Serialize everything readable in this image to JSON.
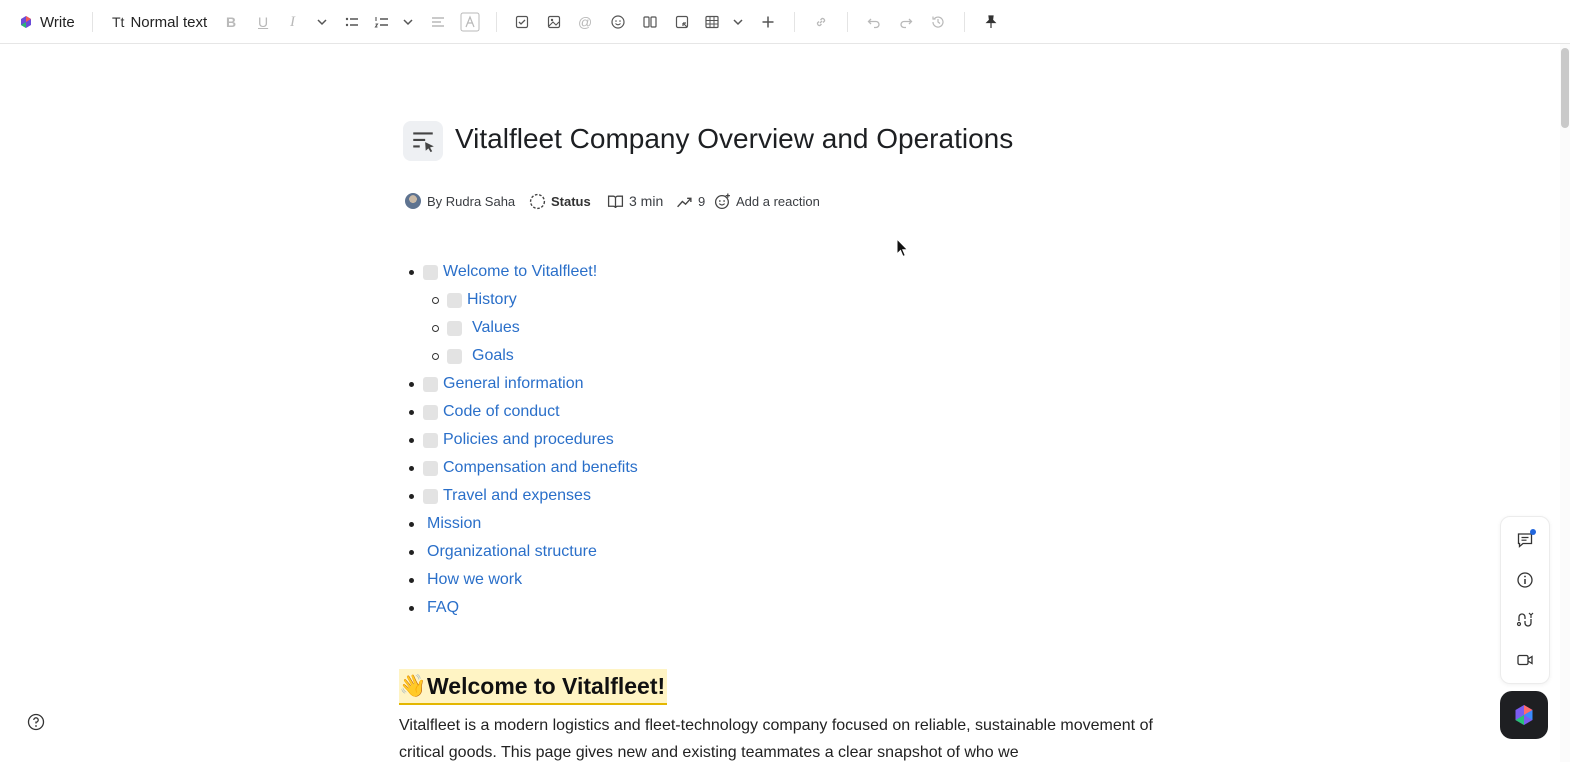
{
  "toolbar": {
    "write_label": "Write",
    "text_style_label": "Normal text",
    "icons": [
      "logo-icon",
      "text-style-icon",
      "bold-icon",
      "underline-icon",
      "italic-icon",
      "chevron-down-icon",
      "bulleted-list-icon",
      "numbered-list-icon",
      "chevron-down-icon",
      "align-icon",
      "text-color-icon",
      "checklist-icon",
      "image-icon",
      "mention-icon",
      "emoji-icon",
      "columns-icon",
      "embed-icon",
      "table-icon",
      "chevron-down-icon",
      "insert-icon",
      "link-icon",
      "undo-icon",
      "redo-icon",
      "history-icon",
      "pin-icon"
    ]
  },
  "doc": {
    "title": "Vitalfleet Company Overview and Operations",
    "author": "By Rudra Saha",
    "status": "Status",
    "read_time": "3 min",
    "views": "9",
    "reaction": "Add a reaction"
  },
  "toc": [
    {
      "label": "Welcome to Vitalfleet!",
      "level": 1,
      "checkbox": true
    },
    {
      "label": "History",
      "level": 2,
      "checkbox": true
    },
    {
      "label": "Values",
      "level": 2,
      "checkbox": true
    },
    {
      "label": "Goals",
      "level": 2,
      "checkbox": true
    },
    {
      "label": "General information",
      "level": 1,
      "checkbox": true
    },
    {
      "label": "Code of conduct",
      "level": 1,
      "checkbox": true
    },
    {
      "label": "Policies and procedures",
      "level": 1,
      "checkbox": true
    },
    {
      "label": "Compensation and benefits",
      "level": 1,
      "checkbox": true
    },
    {
      "label": "Travel and expenses",
      "level": 1,
      "checkbox": true
    },
    {
      "label": "Mission",
      "level": 1,
      "checkbox": false
    },
    {
      "label": "Organizational structure",
      "level": 1,
      "checkbox": false
    },
    {
      "label": "How we work",
      "level": 1,
      "checkbox": false
    },
    {
      "label": "FAQ",
      "level": 1,
      "checkbox": false
    }
  ],
  "section": {
    "emoji": "👋",
    "heading": "Welcome to Vitalfleet!",
    "paragraph": "Vitalfleet is a modern logistics and fleet-technology company focused on reliable, sustainable movement of critical goods. This page gives new and existing teammates a clear snapshot of who we"
  },
  "colors": {
    "link": "#2a6fc9",
    "highlight": "#fff4c4",
    "notification": "#2266dd"
  }
}
